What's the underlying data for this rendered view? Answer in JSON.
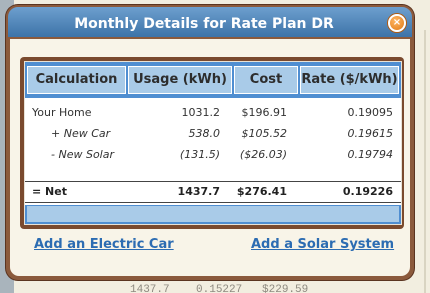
{
  "modal": {
    "title": "Monthly Details for Rate Plan DR",
    "close_icon": "close-icon"
  },
  "table": {
    "headers": [
      "Calculation",
      "Usage (kWh)",
      "Cost",
      "Rate ($/kWh)"
    ],
    "rows": [
      {
        "label": "Your Home",
        "usage": "1031.2",
        "cost": "$196.91",
        "rate": "0.19095"
      },
      {
        "label": "+ New Car",
        "usage": "538.0",
        "cost": "$105.52",
        "rate": "0.19615"
      },
      {
        "label": "- New Solar",
        "usage": "(131.5)",
        "cost": "($26.03)",
        "rate": "0.19794"
      }
    ],
    "net": {
      "label": "= Net",
      "usage": "1437.7",
      "cost": "$276.41",
      "rate": "0.19226"
    }
  },
  "links": {
    "add_car": "Add an Electric Car",
    "add_solar": "Add a Solar System"
  },
  "background": {
    "partial_row": "1437.7    0.15227   $229.59"
  },
  "colors": {
    "title_bar": "#4f82b8",
    "frame": "#8b5a3c",
    "header_bg": "#a9cbe8",
    "link": "#2c6cb2",
    "close_button": "#e07a14"
  }
}
